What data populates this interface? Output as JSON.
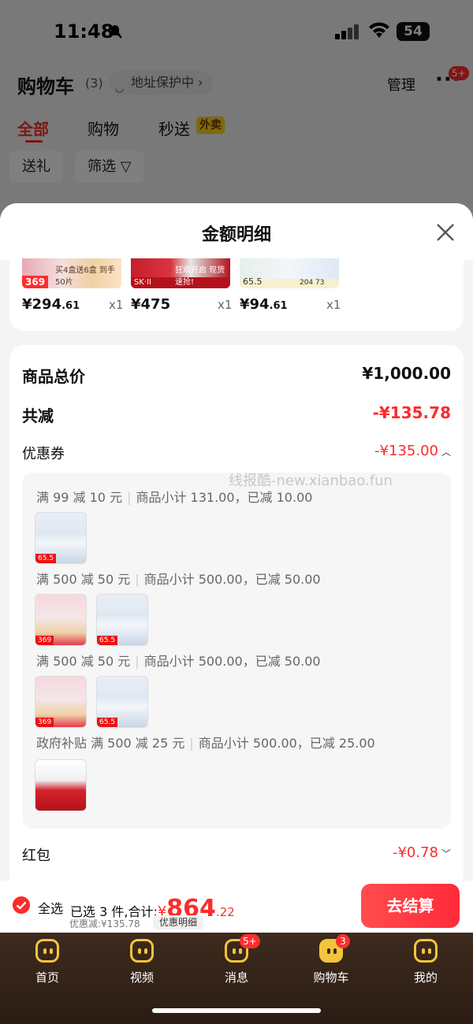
{
  "status_bar": {
    "time": "11:48",
    "battery": "54"
  },
  "header": {
    "title": "购物车",
    "count": "(3)",
    "address_protect": "地址保护中 ›",
    "manage": "管理",
    "more_badge": "5+"
  },
  "tabs": [
    {
      "label": "全部"
    },
    {
      "label": "购物"
    },
    {
      "label": "秒送"
    }
  ],
  "tab_badge": "外卖",
  "chips": [
    {
      "label": "送礼"
    },
    {
      "label": "筛选 ▽"
    }
  ],
  "sheet": {
    "title": "金额明细",
    "products": [
      {
        "price_int": "¥294",
        "price_dec": ".61",
        "qty": "x1",
        "thumb_tag": "369",
        "thumb_text": "买4盒送6盒 到手50片"
      },
      {
        "price_int": "¥475",
        "price_dec": "",
        "qty": "x1",
        "thumb_tag": "SK·II",
        "thumb_text": "狂欢开启 现货速抢!"
      },
      {
        "price_int": "¥94",
        "price_dec": ".61",
        "qty": "x1",
        "thumb_tag": "65.5",
        "thumb_text": "204 73"
      }
    ],
    "total_label": "商品总价",
    "total_value": "¥1,000.00",
    "discount_label": "共减",
    "discount_value": "-¥135.78",
    "coupon_label": "优惠券",
    "coupon_value": "-¥135.00",
    "coupon_lines": [
      {
        "title": "满 99 减 10 元",
        "detail": "商品小计 131.00，已减 10.00"
      },
      {
        "title": "满 500 减 50 元",
        "detail": "商品小计 500.00，已减 50.00"
      },
      {
        "title": "满 500 减 50 元",
        "detail": "商品小计 500.00，已减 50.00"
      },
      {
        "title": "政府补贴 满 500 减 25 元",
        "detail": "商品小计 500.00，已减 25.00"
      }
    ],
    "thumb_tags": {
      "pink": "369",
      "blue": "65.5"
    },
    "hongbao_label": "红包",
    "hongbao_value": "-¥0.78"
  },
  "watermark": "线报酷-new.xianbao.fun",
  "checkout": {
    "select_all": "全选",
    "selected_text": "已选 3 件,合计:",
    "currency": "¥",
    "total_int": "864",
    "total_dec": ".22",
    "discount_text": "优惠减:¥135.78",
    "detail_button": "优惠明细",
    "pay_button": "去结算"
  },
  "tabbar": [
    {
      "label": "首页",
      "badge": ""
    },
    {
      "label": "视频",
      "badge": ""
    },
    {
      "label": "消息",
      "badge": "5+"
    },
    {
      "label": "购物车",
      "badge": "3"
    },
    {
      "label": "我的",
      "badge": ""
    }
  ],
  "colors": {
    "accent": "#ff2a2a",
    "tabbar_bg": "#2b1d14",
    "tab_icon": "#f3c53c"
  }
}
